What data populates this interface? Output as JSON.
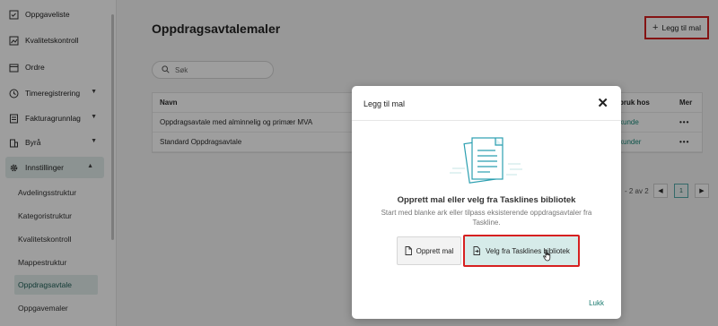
{
  "sidebar": {
    "items": [
      {
        "label": "Oppgaveliste",
        "icon": "checklist-icon"
      },
      {
        "label": "Kvalitetskontroll",
        "icon": "chart-icon"
      },
      {
        "label": "Ordre",
        "icon": "calendar-icon"
      },
      {
        "label": "Timeregistrering",
        "icon": "clock-icon",
        "expandable": true
      },
      {
        "label": "Fakturagrunnlag",
        "icon": "invoice-icon",
        "expandable": true
      },
      {
        "label": "Byrå",
        "icon": "building-icon",
        "expandable": true
      },
      {
        "label": "Innstillinger",
        "icon": "gear-icon",
        "expandable": true,
        "expanded": true
      }
    ],
    "subitems": [
      {
        "label": "Avdelingsstruktur"
      },
      {
        "label": "Kategoristruktur"
      },
      {
        "label": "Kvalitetskontroll"
      },
      {
        "label": "Mappestruktur"
      },
      {
        "label": "Oppdragsavtale",
        "active": true
      },
      {
        "label": "Oppgavemaler"
      }
    ]
  },
  "main": {
    "title": "Oppdragsavtalemaler",
    "add_button": "Legg til mal",
    "search_placeholder": "Søk",
    "table": {
      "headers": [
        "Navn",
        "bruk hos",
        "Mer"
      ],
      "rows": [
        {
          "name": "Oppdragsavtale med alminnelig og primær MVA",
          "usage": "kunde",
          "more": "•••"
        },
        {
          "name": "Standard Oppdragsavtale",
          "usage": "kunder",
          "more": "•••"
        }
      ]
    },
    "pager": {
      "text": "- 2 av 2",
      "current_page": "1",
      "prev": "◀",
      "next": "▶"
    }
  },
  "modal": {
    "title": "Legg til mal",
    "close_glyph": "✕",
    "heading": "Opprett mal eller velg fra Tasklines bibliotek",
    "description": "Start med blanke ark eller tilpass eksisterende oppdragsavtaler fra Taskline.",
    "create_button": "Opprett mal",
    "library_button": "Velg fra Tasklines bibliotek",
    "close_button": "Lukk"
  },
  "colors": {
    "accent": "#1a8a7a",
    "highlight_border": "#d62020",
    "active_bg": "#e2eeec",
    "library_btn_bg": "#d6ebe9"
  }
}
